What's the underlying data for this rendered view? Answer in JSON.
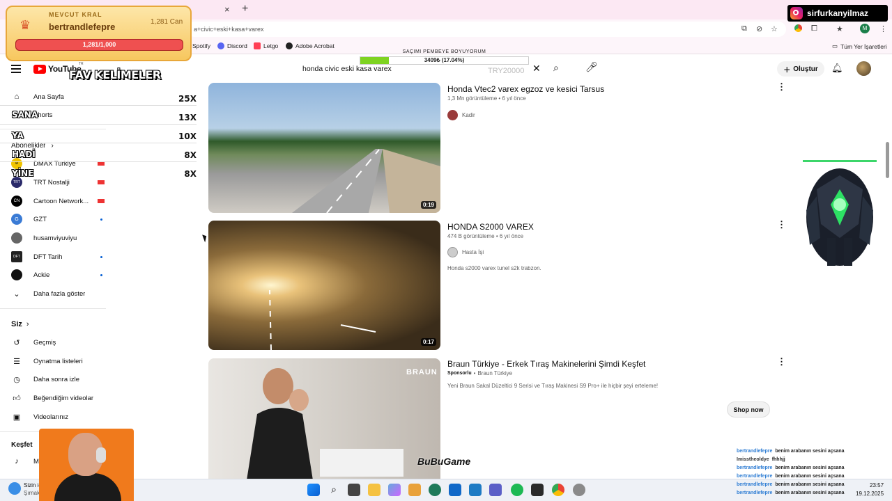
{
  "browser": {
    "tab_close": "×",
    "tab_new": "+",
    "url": "a+civic+eski+kasa+varex",
    "bookmarks": [
      "Spotify",
      "Discord",
      "Letgo",
      "Adobe Acrobat"
    ],
    "all_bookmarks": "Tüm Yer İşaretleri",
    "profile_initial": "M"
  },
  "overlay": {
    "king_label": "MEVCUT KRAL",
    "king_name": "bertrandlefepre",
    "king_can": "1,281 Can",
    "king_progress_text": "1,281/1,000",
    "king_progress": 1.0,
    "instagram": "sirfurkanyilmaz",
    "goal_title": "SAÇIMI PEMBEYE BOYUYORUM",
    "goal_text": "3409₺ (17.04%)",
    "goal_progress": 0.1704,
    "ghost_currency": "TRY20000",
    "fav_title": "FAV KELİMELER",
    "fav_words": [
      {
        "word": "SANA",
        "count": "25X"
      },
      {
        "word": "YA",
        "count": "13X"
      },
      {
        "word": "HADİ",
        "count": "10X"
      },
      {
        "word": "YİNE",
        "count": "8X"
      },
      {
        "word": "",
        "count": "8X"
      }
    ],
    "watermark": "BuBuGame"
  },
  "youtube": {
    "logo_text": "YouTube",
    "logo_region": "TR",
    "search_query": "honda civic eski kasa varex",
    "create_label": "Oluştur",
    "sidebar": {
      "main": [
        {
          "label": "Ana Sayfa",
          "icon": "home-icon"
        },
        {
          "label": "Shorts",
          "icon": "shorts-icon"
        }
      ],
      "subscriptions_heading": "Abonelikler",
      "subscriptions": [
        {
          "label": "DMAX Turkiye",
          "badge": "live"
        },
        {
          "label": "TRT Nostalji",
          "badge": "live"
        },
        {
          "label": "Cartoon Network...",
          "badge": "live"
        },
        {
          "label": "GZT",
          "badge": "dot"
        },
        {
          "label": "husamviyuviyu",
          "badge": ""
        },
        {
          "label": "DFT Tarih",
          "badge": "dot"
        },
        {
          "label": "Ackie",
          "badge": "dot"
        }
      ],
      "show_more": "Daha fazla göster",
      "you_heading": "Siz",
      "you": [
        {
          "label": "Geçmiş",
          "icon": "history-icon"
        },
        {
          "label": "Oynatma listeleri",
          "icon": "playlist-icon"
        },
        {
          "label": "Daha sonra izle",
          "icon": "clock-icon"
        },
        {
          "label": "Beğendiğim videolar",
          "icon": "like-icon"
        },
        {
          "label": "Videolarınız",
          "icon": "video-icon"
        }
      ],
      "explore_heading": "Keşfet",
      "explore": [
        {
          "label": "Müzik",
          "icon": "music-icon"
        }
      ]
    },
    "videos": [
      {
        "title": "Honda Vtec2 varex egzoz ve kesici Tarsus",
        "meta": "1,3 Mn görüntüleme • 6 yıl önce",
        "channel": "Kadir",
        "description": "",
        "duration": "0:19"
      },
      {
        "title": "HONDA S2000 VAREX",
        "meta": "474 B görüntüleme • 6 yıl önce",
        "channel": "Hasta İşi",
        "description": "Honda s2000 varex tunel s2k trabzon.",
        "duration": "0:17"
      },
      {
        "title": "Braun Türkiye - Erkek Tıraş Makinelerini Şimdi Keşfet",
        "sponsor": "Sponsorlu",
        "channel": "Braun Türkiye",
        "description": "Yeni Braun Sakal Düzeltici 9 Serisi ve Tıraş Makinesi S9 Pro+ ile hiçbir şeyi erteleme!",
        "shop_label": "Shop now",
        "brand": "BRAUN"
      }
    ]
  },
  "chat": [
    {
      "user": "bertrandlefepre",
      "msg": "benim arabanın sesini açsana"
    },
    {
      "user": "Imisstheoldye",
      "msg": "fhhhjj"
    },
    {
      "user": "bertrandlefepre",
      "msg": "benim arabanın sesini açsana"
    },
    {
      "user": "bertrandlefepre",
      "msg": "benim arabanın sesini açsana"
    },
    {
      "user": "bertrandlefepre",
      "msg": "benim arabanın sesini açsana"
    },
    {
      "user": "bertrandlefepre",
      "msg": "benim arabanın sesini açsana"
    }
  ],
  "taskbar": {
    "weather_text": "Sizin içi",
    "weather_sub": "Şırnak",
    "time": "23:57",
    "date": "19.12.2025"
  }
}
